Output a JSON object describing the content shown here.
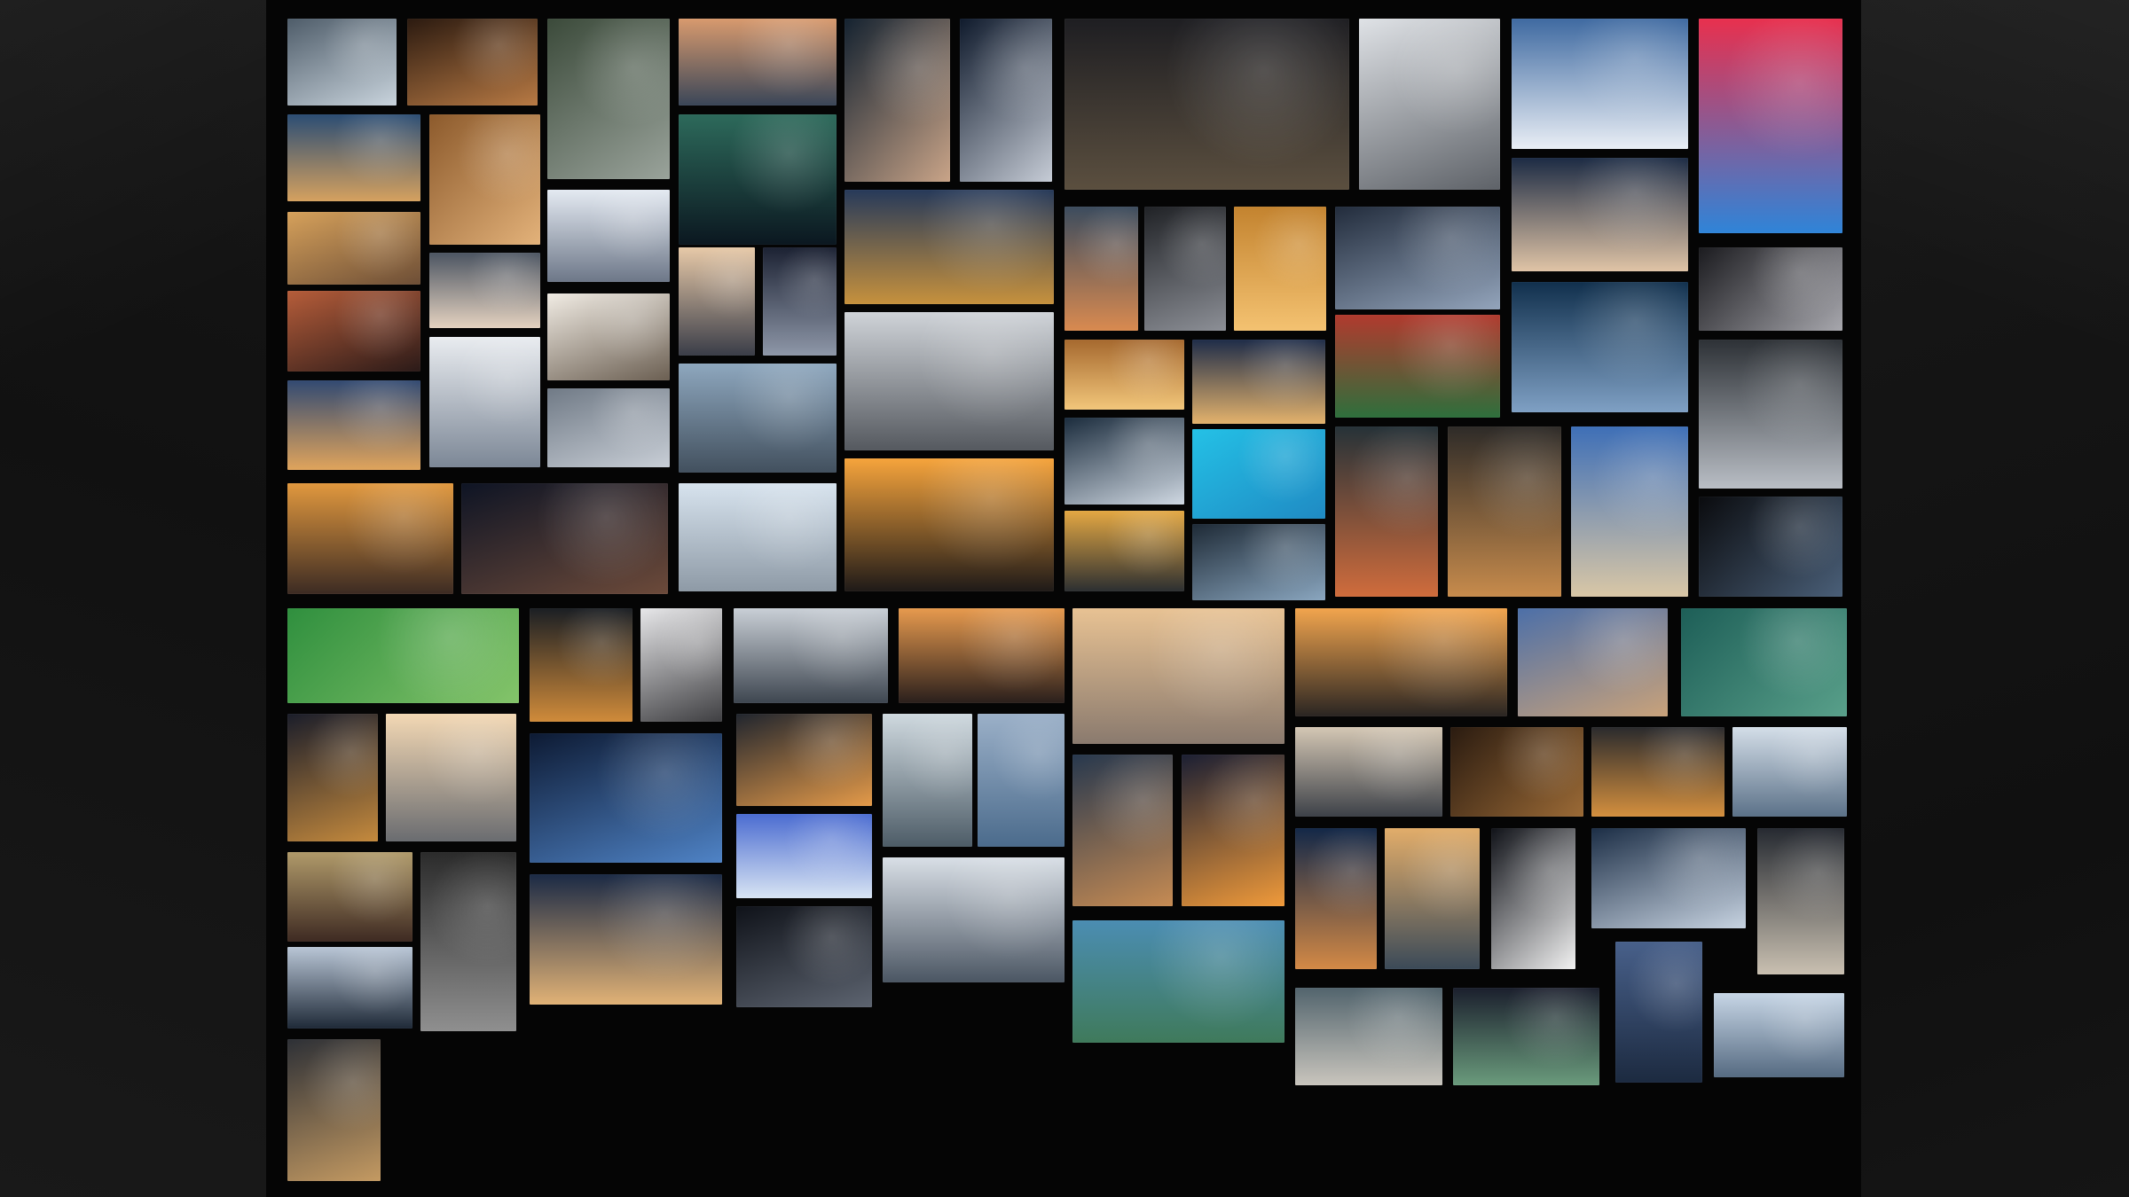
{
  "palette": {
    "board": "#050505",
    "side": "#151515"
  },
  "collage": {
    "tiles": [
      {
        "c1": "#4e5c69",
        "c2": "#c9d4dd",
        "a": 155
      },
      {
        "c1": "#2b1a10",
        "c2": "#b87a44",
        "a": 160
      },
      {
        "c1": "#3b4a3a",
        "c2": "#9aa39b",
        "a": 145
      },
      {
        "c1": "#d89a6e",
        "c2": "#3a4658",
        "a": 180
      },
      {
        "c1": "#142230",
        "c2": "#c9a488",
        "a": 130
      },
      {
        "c1": "#0f1a2c",
        "c2": "#c6ccd6",
        "a": 135
      },
      {
        "c1": "#1e1e22",
        "c2": "#5b4f3f",
        "a": 180
      },
      {
        "c1": "#dfe2e6",
        "c2": "#5e6268",
        "a": 160
      },
      {
        "c1": "#3f6aa1",
        "c2": "#e9eef5",
        "a": 180
      },
      {
        "c1": "#e8304e",
        "c2": "#2f84d8",
        "a": 180
      },
      {
        "c1": "#2b4d74",
        "c2": "#d5a15f",
        "a": 180
      },
      {
        "c1": "#8c5a2c",
        "c2": "#e3b27a",
        "a": 135
      },
      {
        "c1": "#2d6a5b",
        "c2": "#0b1720",
        "a": 180
      },
      {
        "c1": "#1c2b44",
        "c2": "#e0c4a6",
        "a": 180
      },
      {
        "c1": "#d6a15b",
        "c2": "#6d4e36",
        "a": 160
      },
      {
        "c1": "#e4eaf2",
        "c2": "#6d7788",
        "a": 180
      },
      {
        "c1": "#273a5a",
        "c2": "#c6913d",
        "a": 180
      },
      {
        "c1": "#3c4c5e",
        "c2": "#d98a50",
        "a": 180
      },
      {
        "c1": "#202226",
        "c2": "#8c8f96",
        "a": 160
      },
      {
        "c1": "#c3832f",
        "c2": "#f4c271",
        "a": 180
      },
      {
        "c1": "#222c3c",
        "c2": "#93a4bb",
        "a": 160
      },
      {
        "c1": "#1b1b1f",
        "c2": "#a7a7ad",
        "a": 135
      },
      {
        "c1": "#b65d3a",
        "c2": "#2b1a18",
        "a": 160
      },
      {
        "c1": "#4c5562",
        "c2": "#e4d2c0",
        "a": 180
      },
      {
        "c1": "#e7c9a8",
        "c2": "#3a3d48",
        "a": 180
      },
      {
        "c1": "#1c2233",
        "c2": "#8e97a8",
        "a": 180
      },
      {
        "c1": "#f1ece4",
        "c2": "#6b5f52",
        "a": 160
      },
      {
        "c1": "#11304d",
        "c2": "#7fa0c4",
        "a": 180
      },
      {
        "c1": "#b13a2e",
        "c2": "#2e6f3c",
        "a": 180
      },
      {
        "c1": "#e9ecf0",
        "c2": "#7c8796",
        "a": 180
      },
      {
        "c1": "#324a72",
        "c2": "#e0a45c",
        "a": 180
      },
      {
        "c1": "#707a86",
        "c2": "#c8ced6",
        "a": 160
      },
      {
        "c1": "#8ea7be",
        "c2": "#42505e",
        "a": 180
      },
      {
        "c1": "#cfd3d8",
        "c2": "#55595f",
        "a": 180
      },
      {
        "c1": "#a6692f",
        "c2": "#f2c67a",
        "a": 180
      },
      {
        "c1": "#1f2d49",
        "c2": "#e3b26c",
        "a": 180
      },
      {
        "c1": "#2d3136",
        "c2": "#b9bec5",
        "a": 180
      },
      {
        "c1": "#1b2c3d",
        "c2": "#cfd8e2",
        "a": 160
      },
      {
        "c1": "#24c1e6",
        "c2": "#1f8ac3",
        "a": 150
      },
      {
        "c1": "#263238",
        "c2": "#d06c3c",
        "a": 180
      },
      {
        "c1": "#2e2b28",
        "c2": "#c78b4c",
        "a": 180
      },
      {
        "c1": "#3e6fb7",
        "c2": "#d9c7a6",
        "a": 180
      },
      {
        "c1": "#e1983e",
        "c2": "#3c2b23",
        "a": 180
      },
      {
        "c1": "#0e1424",
        "c2": "#6c4a3a",
        "a": 160
      },
      {
        "c1": "#d7e3ee",
        "c2": "#8e9aa6",
        "a": 180
      },
      {
        "c1": "#f6a43c",
        "c2": "#1f1a18",
        "a": 180
      },
      {
        "c1": "#e4a843",
        "c2": "#2c2f31",
        "a": 180
      },
      {
        "c1": "#1e2a36",
        "c2": "#8aa6bf",
        "a": 160
      },
      {
        "c1": "#0a0b0e",
        "c2": "#4a5f78",
        "a": 135
      },
      {
        "c1": "#2f8f3e",
        "c2": "#84c46a",
        "a": 135
      },
      {
        "c1": "#1b1f24",
        "c2": "#d08b3a",
        "a": 180
      },
      {
        "c1": "#e7e7e9",
        "c2": "#3f3f42",
        "a": 160
      },
      {
        "c1": "#c9cfd6",
        "c2": "#3e4650",
        "a": 180
      },
      {
        "c1": "#e79a4e",
        "c2": "#2a1f1c",
        "a": 180
      },
      {
        "c1": "#e8c293",
        "c2": "#8a7a6e",
        "a": 180
      },
      {
        "c1": "#f2a54e",
        "c2": "#2a2522",
        "a": 180
      },
      {
        "c1": "#4c6fa8",
        "c2": "#c9a27a",
        "a": 160
      },
      {
        "c1": "#1d5e57",
        "c2": "#59a08a",
        "a": 135
      },
      {
        "c1": "#1a1d2a",
        "c2": "#c58a3d",
        "a": 160
      },
      {
        "c1": "#f3d8b4",
        "c2": "#6a6c70",
        "a": 180
      },
      {
        "c1": "#0d1a33",
        "c2": "#4f83c6",
        "a": 160
      },
      {
        "c1": "#20252e",
        "c2": "#e49a49",
        "a": 160
      },
      {
        "c1": "#cfd9df",
        "c2": "#4d5c67",
        "a": 180
      },
      {
        "c1": "#9bb0c8",
        "c2": "#4b6b8c",
        "a": 180
      },
      {
        "c1": "#27384e",
        "c2": "#c68b53",
        "a": 160
      },
      {
        "c1": "#1b1f33",
        "c2": "#f09a3a",
        "a": 160
      },
      {
        "c1": "#d4c7b4",
        "c2": "#3d4148",
        "a": 180
      },
      {
        "c1": "#2a1b10",
        "c2": "#9b6a36",
        "a": 135
      },
      {
        "c1": "#2a2a2d",
        "c2": "#d48f3e",
        "a": 180
      },
      {
        "c1": "#d4dee8",
        "c2": "#5b7188",
        "a": 180
      },
      {
        "c1": "#4b6cd1",
        "c2": "#d8e4f3",
        "a": 180
      },
      {
        "c1": "#b09a6a",
        "c2": "#3e2a22",
        "a": 180
      },
      {
        "c1": "#2b2b2b",
        "c2": "#8f8f8f",
        "a": 180
      },
      {
        "c1": "#1b2a45",
        "c2": "#e1b276",
        "a": 180
      },
      {
        "c1": "#0f1219",
        "c2": "#5d6470",
        "a": 160
      },
      {
        "c1": "#d9dfe6",
        "c2": "#4b5663",
        "a": 180
      },
      {
        "c1": "#132848",
        "c2": "#d38946",
        "a": 180
      },
      {
        "c1": "#e2ad6a",
        "c2": "#3b4a58",
        "a": 180
      },
      {
        "c1": "#101218",
        "c2": "#f2f2f2",
        "a": 135
      },
      {
        "c1": "#1c2e46",
        "c2": "#c7d3e1",
        "a": 160
      },
      {
        "c1": "#262a31",
        "c2": "#c9c0b1",
        "a": 180
      },
      {
        "c1": "#b9c6d6",
        "c2": "#1f2a38",
        "a": 180
      },
      {
        "c1": "#4b8db2",
        "c2": "#3f7a5b",
        "a": 180
      },
      {
        "c1": "#48608a",
        "c2": "#1c2a40",
        "a": 180
      },
      {
        "c1": "#52646d",
        "c2": "#c9c5bd",
        "a": 180
      },
      {
        "c1": "#1b1f2d",
        "c2": "#6a9b7c",
        "a": 180
      },
      {
        "c1": "#c7d6e6",
        "c2": "#556a81",
        "a": 180
      },
      {
        "c1": "#2d3036",
        "c2": "#c49a62",
        "a": 160
      }
    ]
  }
}
